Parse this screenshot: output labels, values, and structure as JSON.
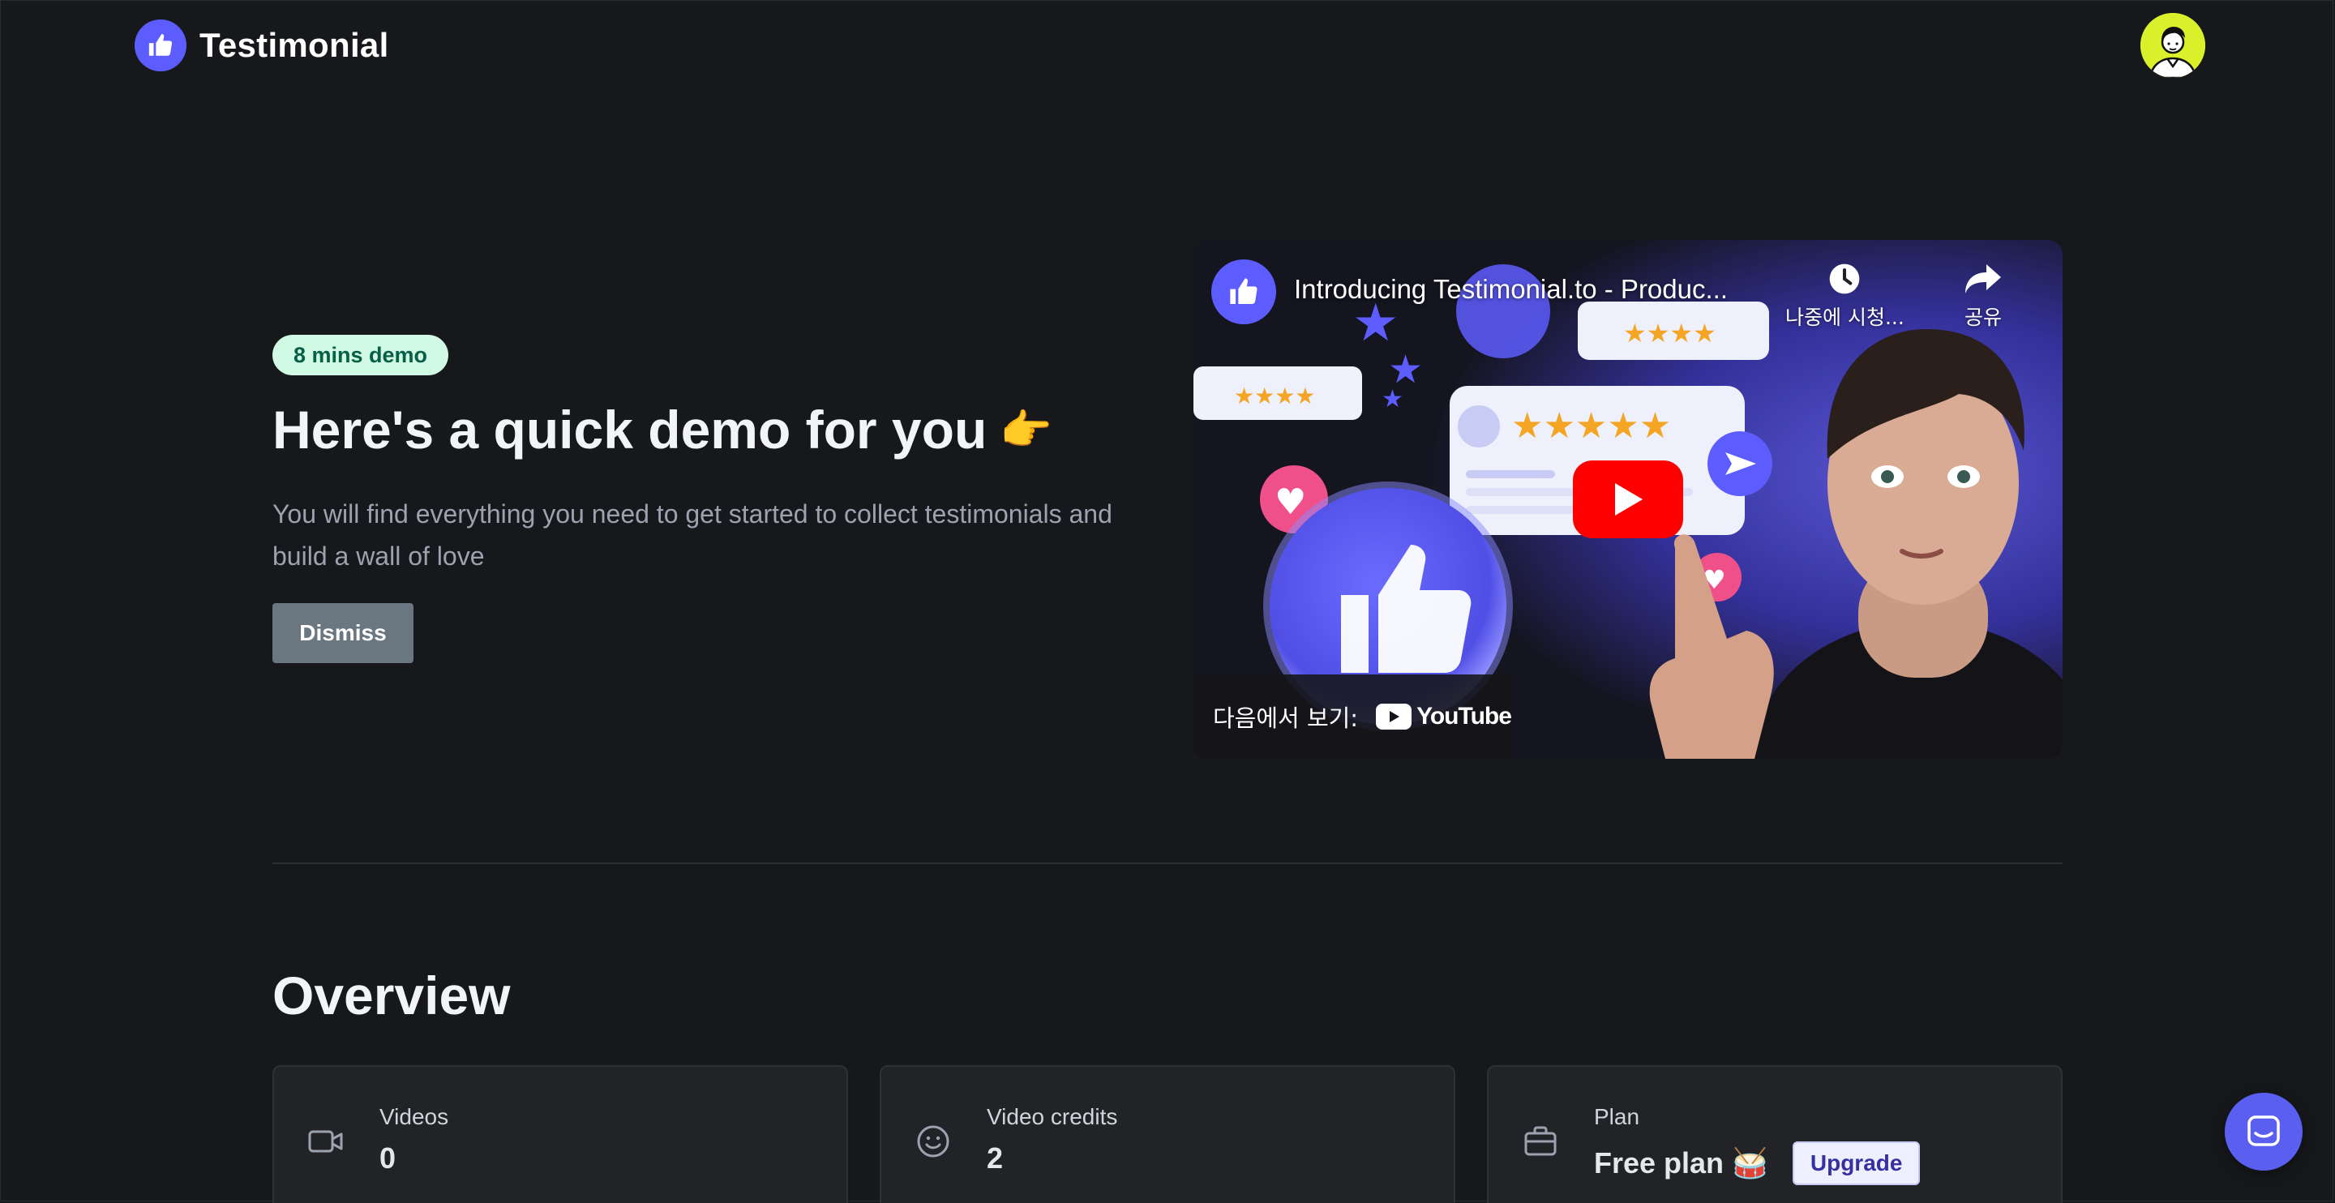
{
  "header": {
    "brand_name": "Testimonial"
  },
  "hero": {
    "badge": "8 mins demo",
    "title": "Here's a quick demo for you",
    "title_emoji": "👉",
    "description": "You will find everything you need to get started to collect testimonials and build a wall of love",
    "dismiss_label": "Dismiss"
  },
  "video": {
    "title": "Introducing Testimonial.to - Produc...",
    "watch_later_label": "나중에 시청...",
    "share_label": "공유",
    "watch_on_label": "다음에서 보기:",
    "platform_label": "YouTube"
  },
  "overview": {
    "title": "Overview",
    "cards": [
      {
        "label": "Videos",
        "value": "0",
        "icon": "video-camera-icon"
      },
      {
        "label": "Video credits",
        "value": "2",
        "icon": "smiley-icon"
      },
      {
        "label": "Plan",
        "value": "Free plan 🥁",
        "icon": "briefcase-icon",
        "action": "Upgrade"
      }
    ]
  },
  "colors": {
    "background": "#17181b",
    "brand": "#5d5dff",
    "badge_bg": "#d1fae5",
    "youtube_red": "#ff0000"
  }
}
